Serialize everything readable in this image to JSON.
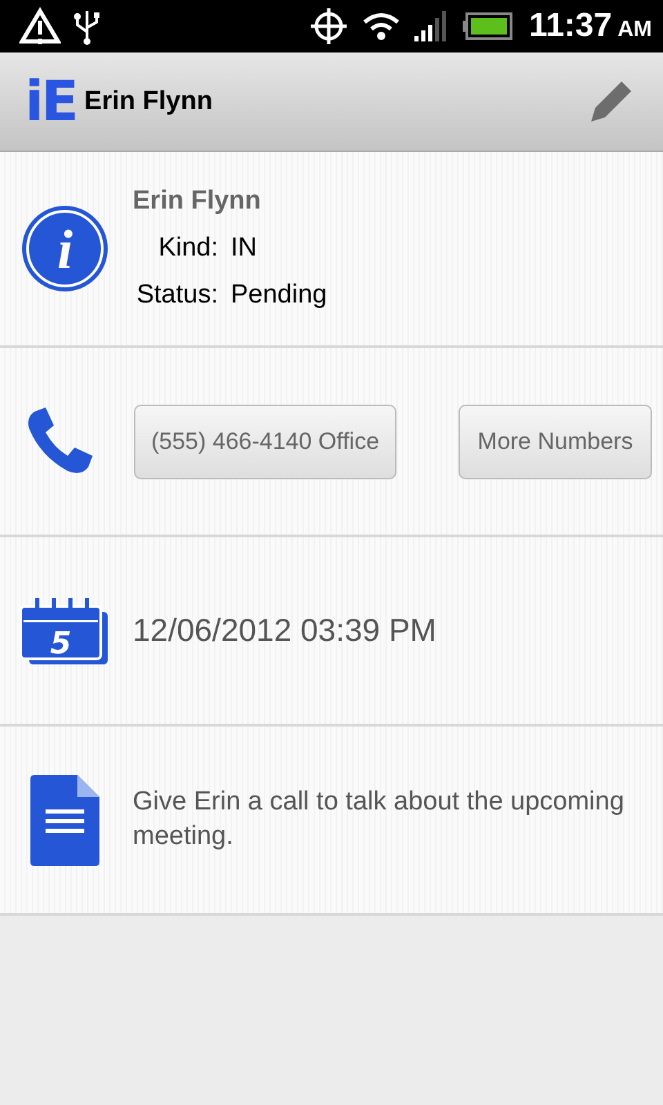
{
  "status_bar": {
    "time": "11:37",
    "meridiem": "AM"
  },
  "action_bar": {
    "logo": "iE",
    "title": "Erin Flynn"
  },
  "info": {
    "glyph": "i",
    "name": "Erin Flynn",
    "fields": [
      {
        "label": "Kind:",
        "value": "IN"
      },
      {
        "label": "Status:",
        "value": "Pending"
      }
    ]
  },
  "phone": {
    "buttons": [
      "(555) 466-4140 Office",
      "More Numbers"
    ]
  },
  "date": {
    "calendar_day": "5",
    "text": "12/06/2012 03:39 PM"
  },
  "note": {
    "text": "Give Erin a call to talk about the upcoming meeting."
  }
}
